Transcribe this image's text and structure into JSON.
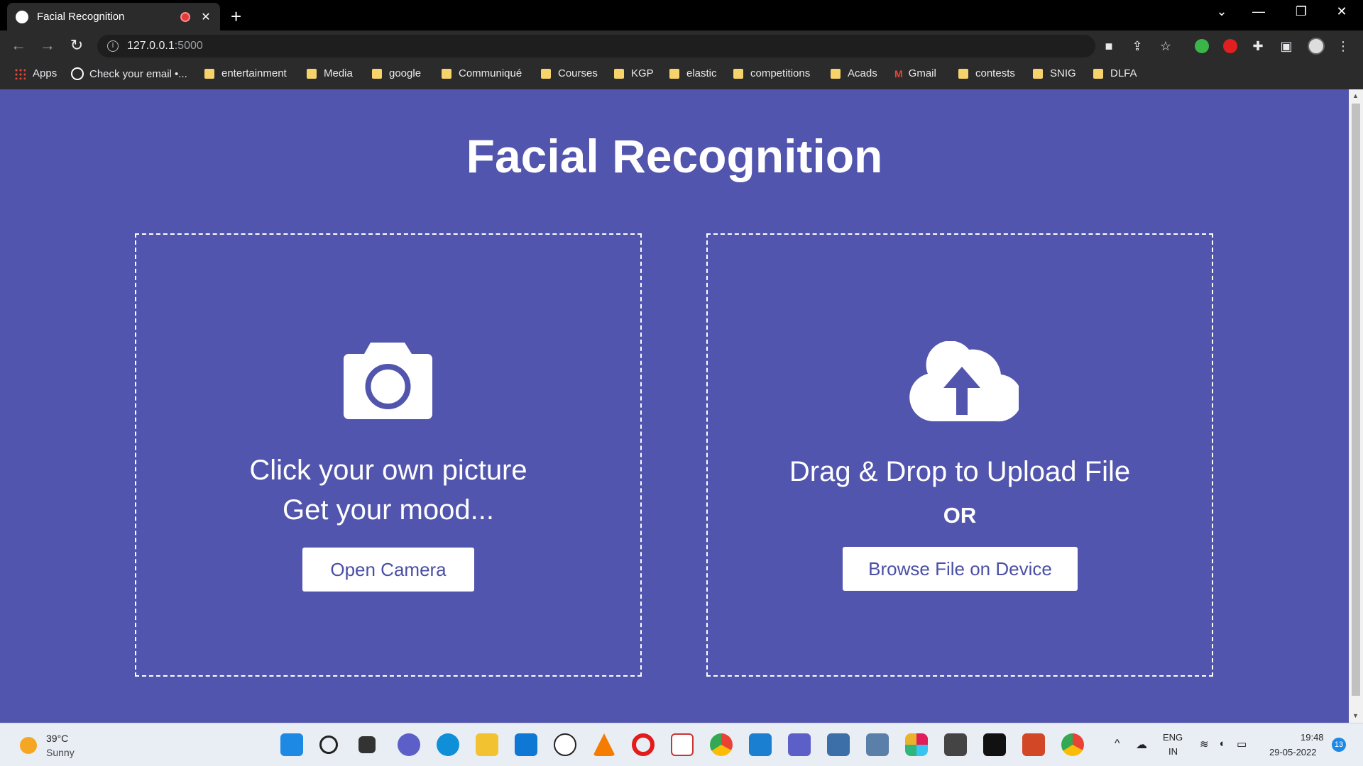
{
  "browser": {
    "tab_title": "Facial Recognition",
    "url_host": "127.0.0.1",
    "url_port": ":5000",
    "bookmarks": [
      "Apps",
      "Check your email •...",
      "entertainment",
      "Media",
      "google",
      "Communiqué",
      "Courses",
      "KGP",
      "elastic",
      "competitions",
      "Acads",
      "Gmail",
      "contests",
      "SNIG",
      "DLFA"
    ]
  },
  "page": {
    "title": "Facial Recognition",
    "camera_panel": {
      "line1": "Click your own picture",
      "line2": "Get your mood...",
      "button": "Open Camera"
    },
    "upload_panel": {
      "line1": "Drag & Drop to Upload File",
      "or": "OR",
      "button": "Browse File on Device"
    },
    "colors": {
      "background": "#5255ad",
      "button_text": "#4b4fa5"
    }
  },
  "taskbar": {
    "temperature": "39°C",
    "condition": "Sunny",
    "lang1": "ENG",
    "lang2": "IN",
    "time": "19:48",
    "date": "29-05-2022",
    "notifications": "13"
  }
}
